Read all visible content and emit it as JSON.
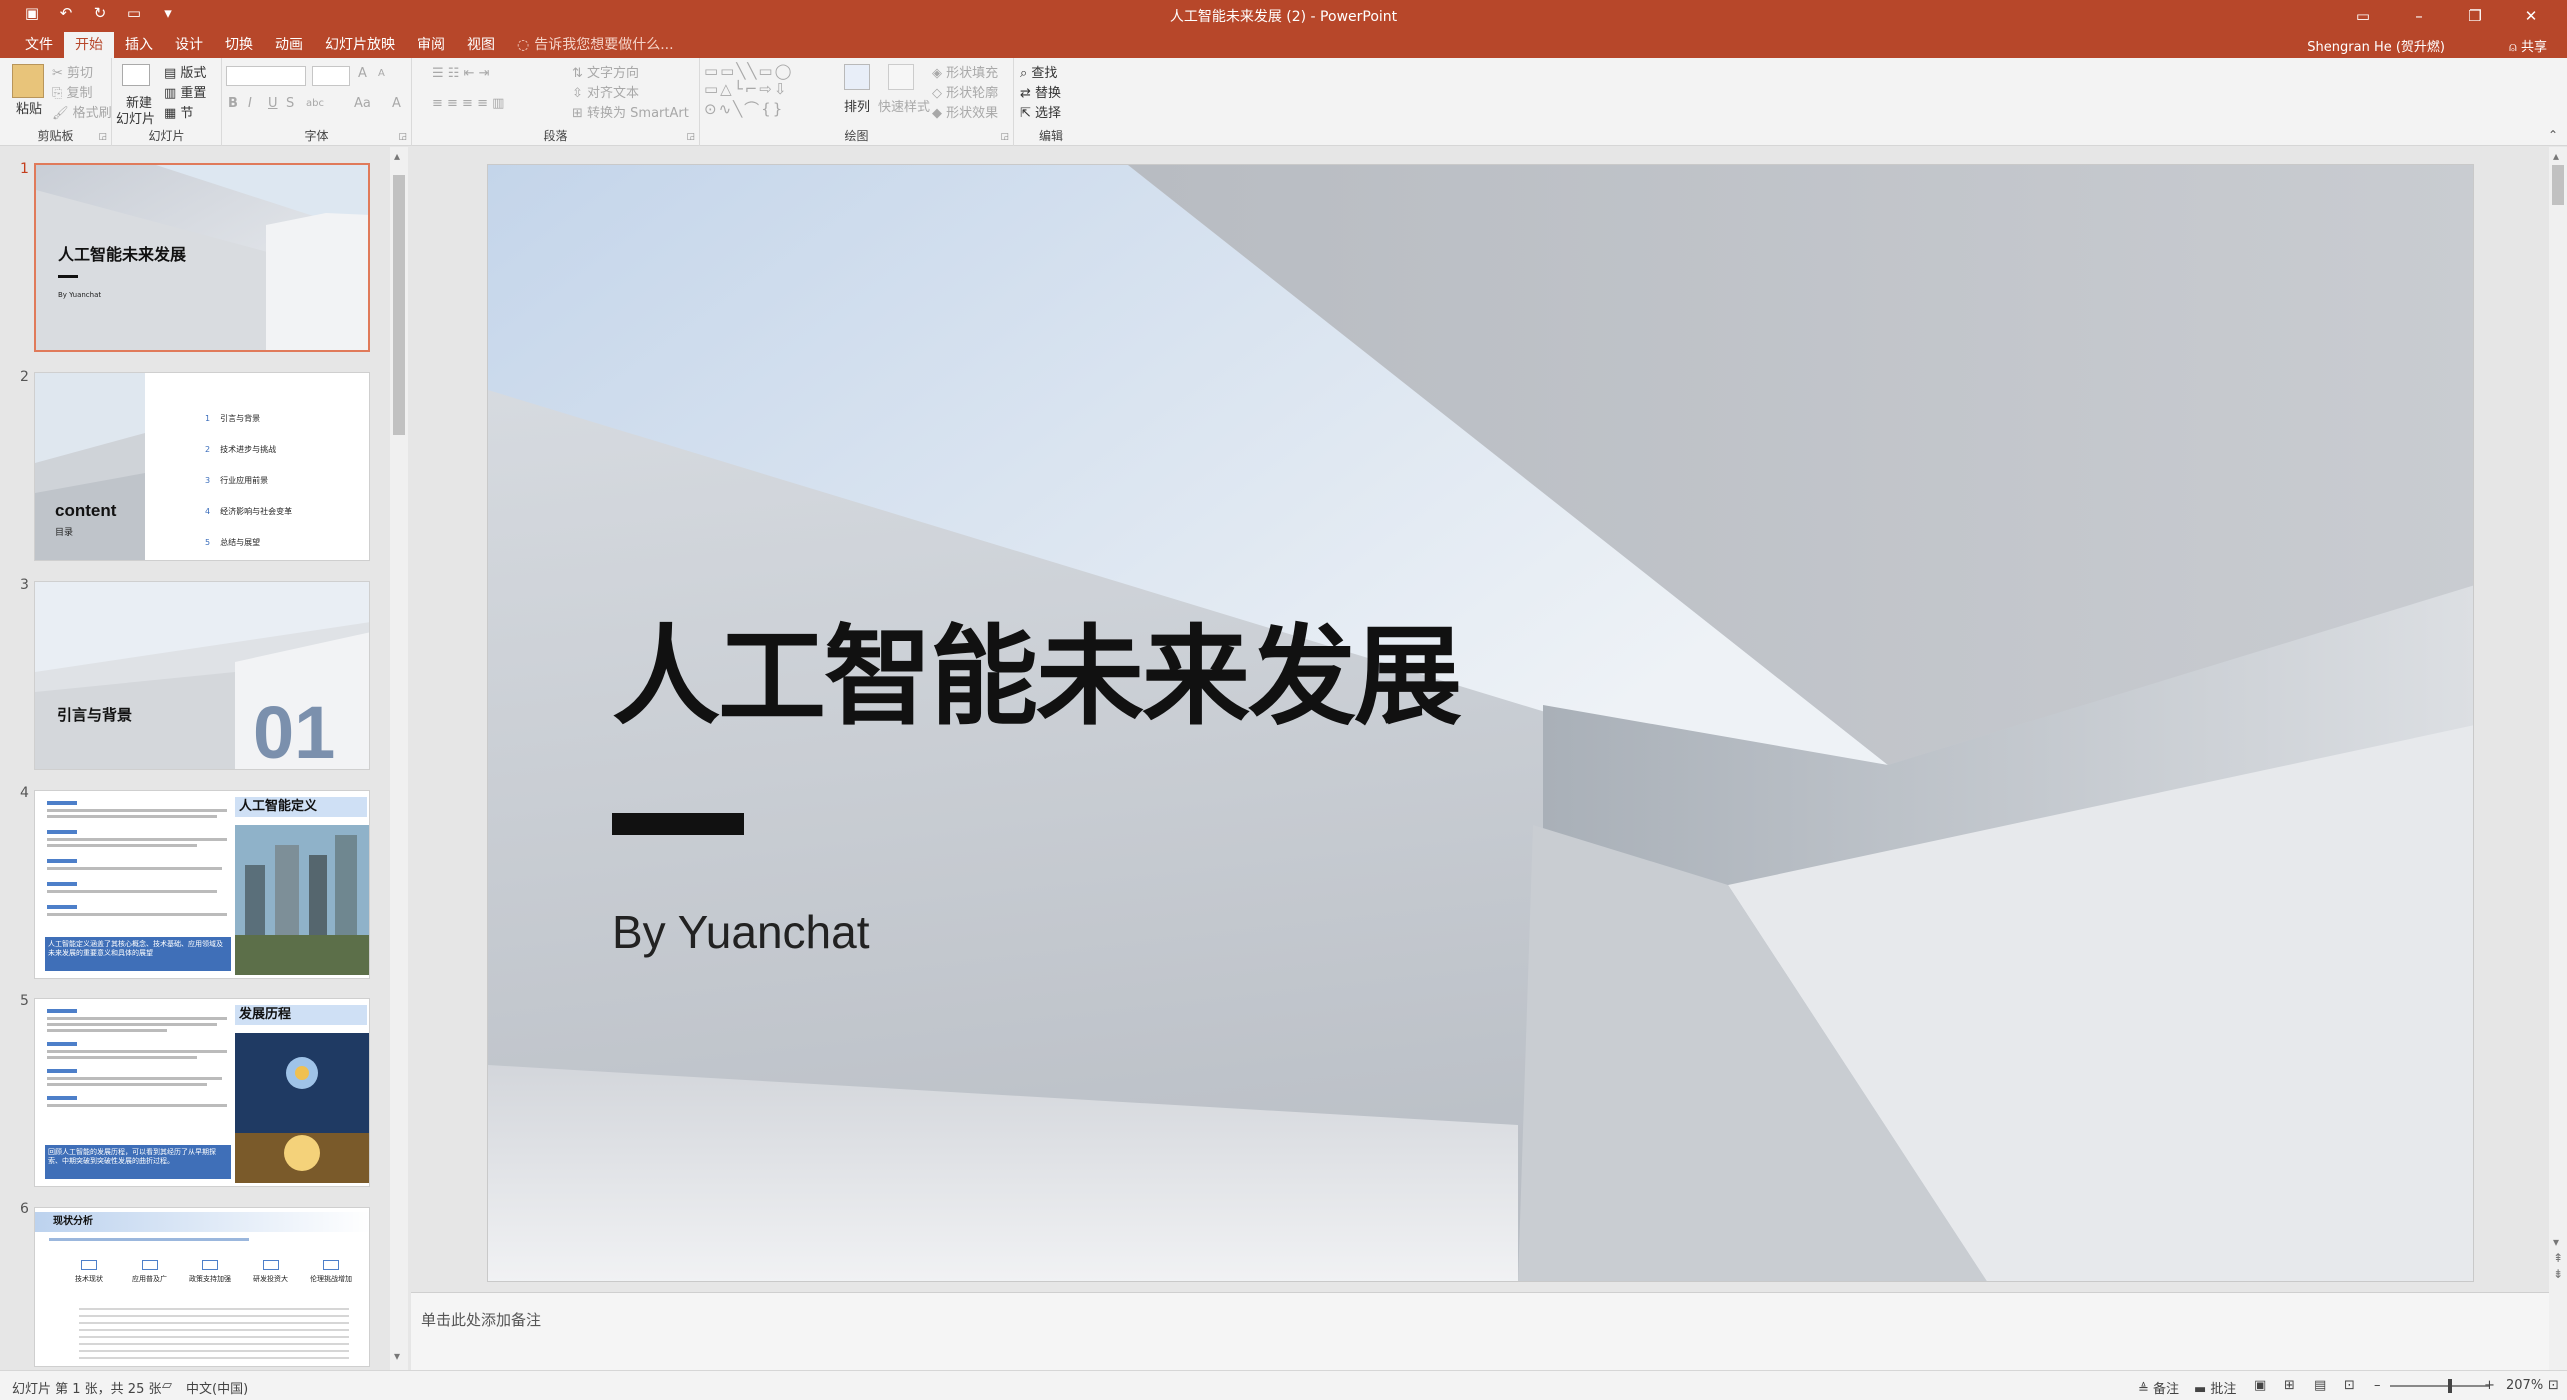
{
  "window": {
    "title": "人工智能未来发展 (2) - PowerPoint",
    "user": "Shengran He (贺升燃)",
    "share": "共享",
    "tellme": "告诉我您想要做什么..."
  },
  "tabs": [
    "文件",
    "开始",
    "插入",
    "设计",
    "切换",
    "动画",
    "幻灯片放映",
    "审阅",
    "视图"
  ],
  "active_tab": "开始",
  "ribbon": {
    "clipboard": {
      "label": "剪贴板",
      "paste": "粘贴",
      "cut": "剪切",
      "copy": "复制",
      "format_painter": "格式刷"
    },
    "slides": {
      "label": "幻灯片",
      "new_slide": "新建",
      "new_slide2": "幻灯片",
      "layout": "版式",
      "reset": "重置",
      "section": "节"
    },
    "font": {
      "label": "字体",
      "bold": "B",
      "italic": "I",
      "underline": "U",
      "strike": "S",
      "spacing": "abc",
      "change_case": "Aa",
      "grow": "A",
      "shrink": "A",
      "font_color": "A"
    },
    "paragraph": {
      "label": "段落",
      "text_direction": "文字方向",
      "align_text": "对齐文本",
      "smartart": "转换为 SmartArt"
    },
    "drawing": {
      "label": "绘图",
      "arrange": "排列",
      "quick_styles": "快速样式",
      "shape_fill": "形状填充",
      "shape_outline": "形状轮廓",
      "shape_effects": "形状效果"
    },
    "editing": {
      "label": "编辑",
      "find": "查找",
      "replace": "替换",
      "select": "选择"
    }
  },
  "thumbnails": [
    {
      "num": "1",
      "title": "人工智能未来发展",
      "sub": "By Yuanchat"
    },
    {
      "num": "2",
      "title": "content",
      "sub": "目录",
      "items": [
        "引言与背景",
        "技术进步与挑战",
        "行业应用前景",
        "经济影响与社会变革",
        "总结与展望"
      ],
      "nums": [
        "1",
        "2",
        "3",
        "4",
        "5"
      ]
    },
    {
      "num": "3",
      "title": "引言与背景",
      "big": "01"
    },
    {
      "num": "4",
      "title": "人工智能定义",
      "callout": "人工智能定义涵盖了其核心概念、技术基础、应用领域及未来发展的重要意义和具体的展望"
    },
    {
      "num": "5",
      "title": "发展历程",
      "callout": "回顾人工智能的发展历程，可以看到其经历了从早期探索、中期突破到突破性发展的曲折过程。"
    },
    {
      "num": "6",
      "title": "现状分析",
      "cols": [
        "技术现状",
        "应用普及广",
        "政策支持加强",
        "研发投资大",
        "伦理挑战增加"
      ]
    }
  ],
  "slide": {
    "title": "人工智能未来发展",
    "subtitle": "By Yuanchat"
  },
  "notes_placeholder": "单击此处添加备注",
  "status": {
    "slide_info": "幻灯片 第 1 张，共 25 张",
    "language": "中文(中国)",
    "notes": "备注",
    "comments": "批注",
    "zoom": "207%"
  }
}
